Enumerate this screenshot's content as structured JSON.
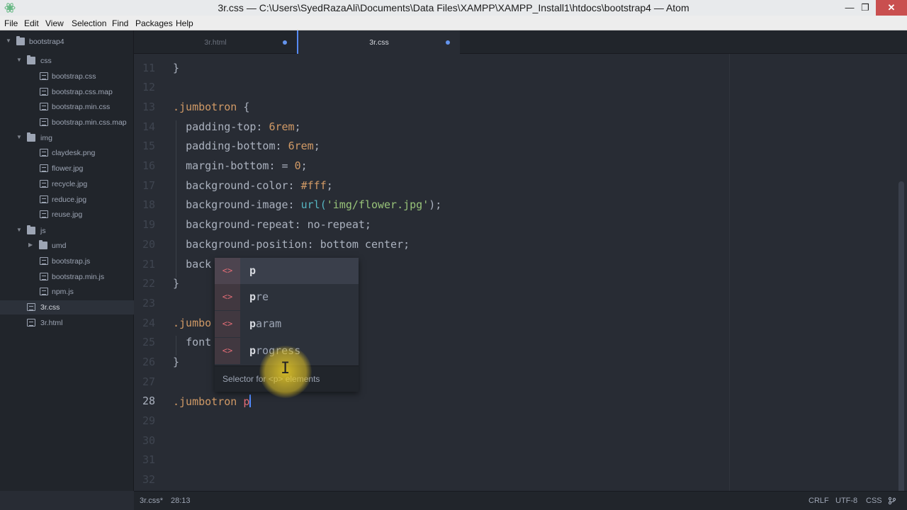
{
  "window": {
    "title": "3r.css — C:\\Users\\SyedRazaAli\\Documents\\Data Files\\XAMPP\\XAMPP_Install1\\htdocs\\bootstrap4 — Atom",
    "minimize": "—",
    "maximize": "❐",
    "close": "✕"
  },
  "menu": [
    "File",
    "Edit",
    "View",
    "Selection",
    "Find",
    "Packages",
    "Help"
  ],
  "tree": [
    {
      "label": "bootstrap4",
      "kind": "folder",
      "expanded": true
    },
    {
      "label": "css",
      "kind": "folder",
      "expanded": true
    },
    {
      "label": "bootstrap.css",
      "kind": "file"
    },
    {
      "label": "bootstrap.css.map",
      "kind": "file"
    },
    {
      "label": "bootstrap.min.css",
      "kind": "file"
    },
    {
      "label": "bootstrap.min.css.map",
      "kind": "file"
    },
    {
      "label": "img",
      "kind": "folder",
      "expanded": true
    },
    {
      "label": "claydesk.png",
      "kind": "file"
    },
    {
      "label": "flower.jpg",
      "kind": "file"
    },
    {
      "label": "recycle.jpg",
      "kind": "file"
    },
    {
      "label": "reduce.jpg",
      "kind": "file"
    },
    {
      "label": "reuse.jpg",
      "kind": "file"
    },
    {
      "label": "js",
      "kind": "folder",
      "expanded": true
    },
    {
      "label": "umd",
      "kind": "folder",
      "expanded": false
    },
    {
      "label": "bootstrap.js",
      "kind": "file"
    },
    {
      "label": "bootstrap.min.js",
      "kind": "file"
    },
    {
      "label": "npm.js",
      "kind": "file"
    },
    {
      "label": "3r.css",
      "kind": "file",
      "selected": true
    },
    {
      "label": "3r.html",
      "kind": "file"
    }
  ],
  "tabs": [
    {
      "label": "3r.html",
      "modified": true,
      "active": false
    },
    {
      "label": "3r.css",
      "modified": true,
      "active": true
    }
  ],
  "editor": {
    "line_numbers": [
      "11",
      "12",
      "13",
      "14",
      "15",
      "16",
      "17",
      "18",
      "19",
      "20",
      "21",
      "22",
      "23",
      "24",
      "25",
      "26",
      "27",
      "28",
      "29",
      "30",
      "31",
      "32"
    ],
    "current_line": "28",
    "lines": {
      "l11": "}",
      "l13_sel": ".jumbotron",
      "l13_brace": " {",
      "l14_prop": "padding-top: ",
      "l14_val": "6rem",
      "l15_prop": "padding-bottom: ",
      "l15_val": "6rem",
      "l16_prop": "margin-bottom: = ",
      "l16_val": "0",
      "l17_prop": "background-color: ",
      "l17_val": "#fff",
      "l18_prop": "background-image: ",
      "l18_fn": "url(",
      "l18_str": "'img/flower.jpg'",
      "l18_end": ");",
      "l19_prop": "background-repeat: ",
      "l19_val": "no-repeat;",
      "l20_prop": "background-position: ",
      "l20_val": "bottom center;",
      "l21": "back",
      "l22": "}",
      "l24": ".jumbo",
      "l25": "font",
      "l26": "}",
      "l28_sel": ".jumbotron ",
      "l28_tag": "p"
    }
  },
  "autocomplete": {
    "icon": "<>",
    "items": [
      {
        "match": "p",
        "rest": ""
      },
      {
        "match": "p",
        "rest": "re"
      },
      {
        "match": "p",
        "rest": "aram"
      },
      {
        "match": "p",
        "rest": "rogress"
      }
    ],
    "description": "Selector for <p> elements"
  },
  "status": {
    "file": "3r.css*",
    "position": "28:13",
    "line_ending": "CRLF",
    "encoding": "UTF-8",
    "grammar": "CSS"
  },
  "colors": {
    "editor_bg": "#282c34",
    "sidebar_bg": "#21252b",
    "accent": "#568af2",
    "tag": "#e06c75",
    "number": "#d19a66",
    "string": "#98c379"
  }
}
